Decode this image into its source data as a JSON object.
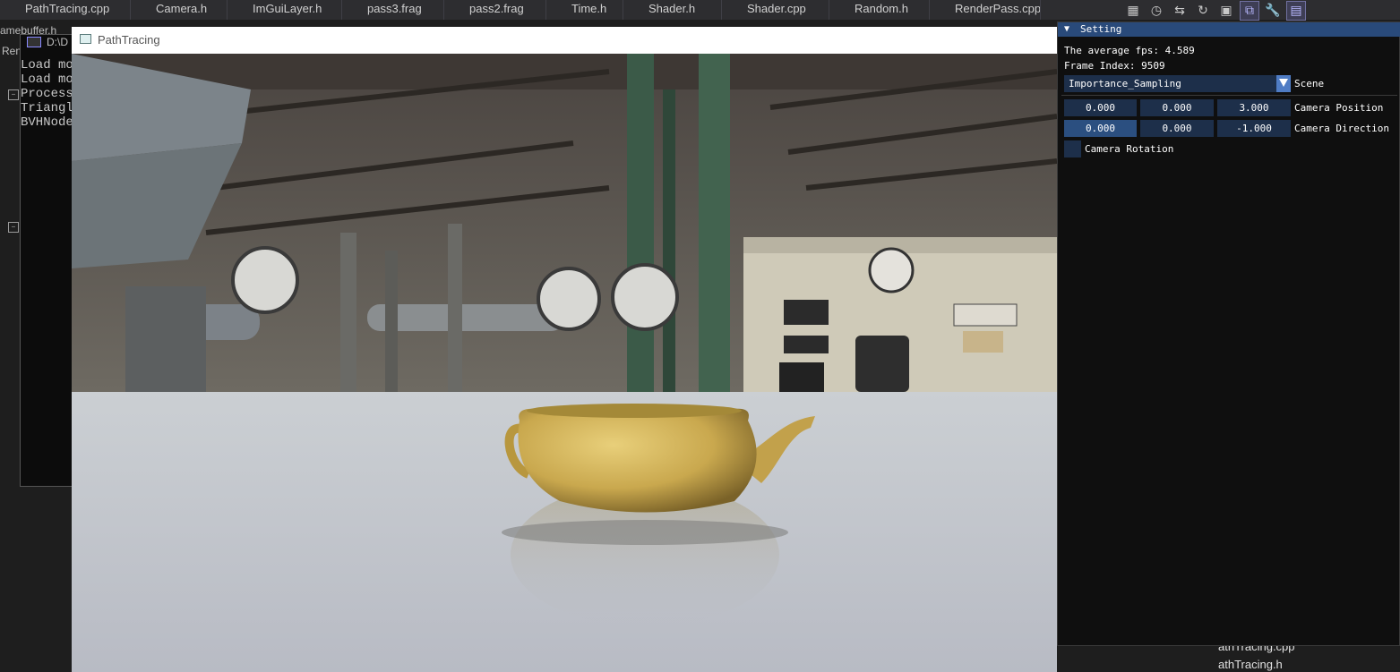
{
  "ide": {
    "tabs": [
      "PathTracing.cpp",
      "Camera.h",
      "ImGuiLayer.h",
      "pass3.frag",
      "pass2.frag",
      "Time.h",
      "Shader.h",
      "Shader.cpp",
      "Random.h",
      "RenderPass.cpp"
    ],
    "left_label": "Ren",
    "behind_crumb": "amebuffer.h"
  },
  "console": {
    "title": "D:\\D",
    "lines": [
      "Load mo",
      "Load mo",
      "Process",
      "Triangl",
      "BVHNode"
    ]
  },
  "solution_explorer": {
    "items": [
      "athTracing.cpp",
      "athTracing.h"
    ]
  },
  "app_window": {
    "title": "PathTracing"
  },
  "settings_panel": {
    "header": "Setting",
    "fps_text": "The average fps: 4.589",
    "frame_text": "Frame Index: 9509",
    "scene": {
      "selected": "Importance_Sampling",
      "label": "Scene"
    },
    "camera_position": {
      "values": [
        "0.000",
        "0.000",
        "3.000"
      ],
      "label": "Camera Position"
    },
    "camera_direction": {
      "values": [
        "0.000",
        "0.000",
        "-1.000"
      ],
      "label": "Camera Direction"
    },
    "camera_rotation": {
      "label": "Camera Rotation",
      "checked": false
    }
  },
  "colors": {
    "accent": "#294a7a",
    "frame_bg": "#1d2f4a",
    "button": "#4f7cc4"
  }
}
